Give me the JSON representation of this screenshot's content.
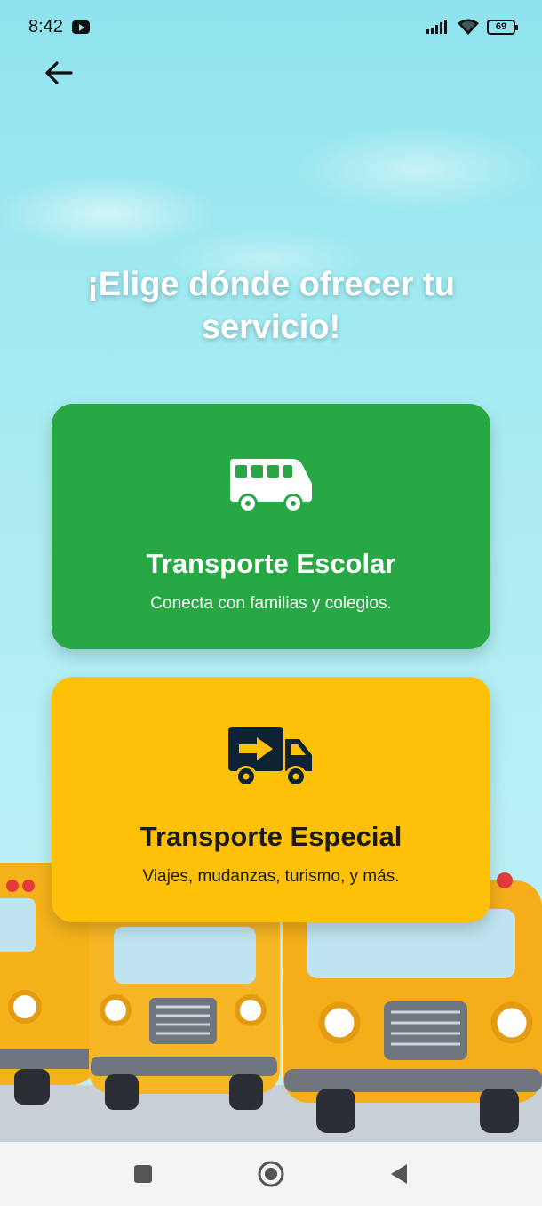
{
  "status_bar": {
    "time": "8:42",
    "battery": "69"
  },
  "header": {
    "title": "¡Elige dónde ofrecer tu servicio!"
  },
  "cards": [
    {
      "title": "Transporte Escolar",
      "subtitle": "Conecta con familias y colegios.",
      "icon": "bus-icon",
      "color": "#28a745"
    },
    {
      "title": "Transporte Especial",
      "subtitle": "Viajes, mudanzas, turismo, y más.",
      "icon": "truck-icon",
      "color": "#ffc107"
    }
  ],
  "nav": {
    "icons": [
      "square-icon",
      "circle-icon",
      "triangle-back-icon"
    ]
  }
}
